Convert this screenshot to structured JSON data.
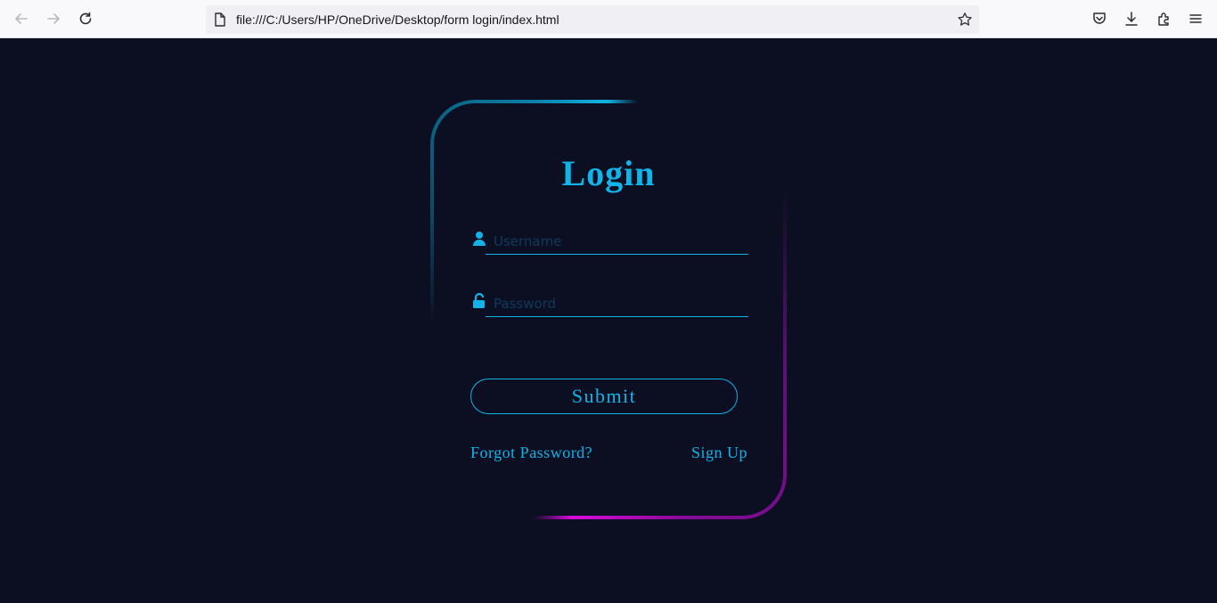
{
  "browser": {
    "url": "file:///C:/Users/HP/OneDrive/Desktop/form login/index.html",
    "icons": [
      "back-arrow-icon",
      "forward-arrow-icon",
      "reload-icon",
      "page-icon",
      "star-icon",
      "pocket-icon",
      "download-icon",
      "extensions-icon",
      "menu-icon"
    ]
  },
  "login": {
    "title": "Login",
    "username_placeholder": "Username",
    "password_placeholder": "Password",
    "submit_label": "Submit",
    "forgot_label": "Forgot Password?",
    "signup_label": "Sign Up"
  },
  "colors": {
    "background": "#0c0f22",
    "accent": "#10b4e8",
    "glow_magenta": "#d70bdc"
  }
}
